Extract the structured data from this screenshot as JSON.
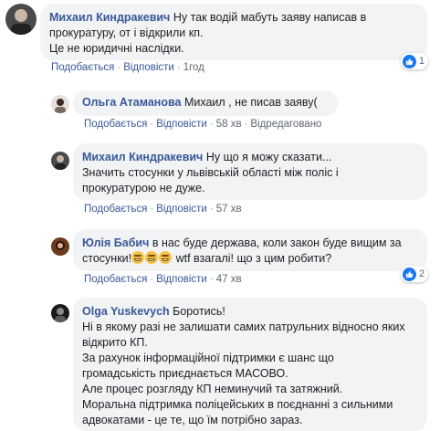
{
  "comments": [
    {
      "author": "Михаил Киндракевич",
      "lines": [
        "Ну так водій мабуть заяву написав в",
        "прокуратуру, от і відкрили кп.",
        "Це не юридичні наслідки."
      ],
      "like": "Подобається",
      "reply": "Відповісти",
      "time": "1год",
      "reaction_count": "1",
      "reaction_icon": "like-icon"
    },
    {
      "author": "Ольга Атаманова",
      "lines": [
        "Михаил , не писав заяву("
      ],
      "like": "Подобається",
      "reply": "Відповісти",
      "time": "58 хв",
      "edited": "Відредаговано"
    },
    {
      "author": "Михаил Киндракевич",
      "lines": [
        "Ну що я можу сказати...",
        "Значить стосунки у львівській області між поліс і",
        "прокуратурою не дуже."
      ],
      "like": "Подобається",
      "reply": "Відповісти",
      "time": "57 хв"
    },
    {
      "author": "Юлія Бабич",
      "lines": [
        "в нас буде держава, коли закон буде вищим за",
        "стосунки!",
        "wtf взагалі! що з цим робити?"
      ],
      "emoji": "grinning-face-emoji",
      "like": "Подобається",
      "reply": "Відповісти",
      "time": "47 хв",
      "reaction_count": "2",
      "reaction_icon": "like-icon"
    },
    {
      "author": "Olga Yuskevych",
      "lines": [
        "Боротись!",
        "Ні в якому разі не залишати самих патрульних відносно яких",
        "відкрито КП.",
        "За рахунок інформаційної підтримки є шанс що",
        "громадськість приєднається МАСОВО.",
        "Але процес розгляду КП неминучий та затяжний.",
        "Моральна підтримка поліцейських в поєднанні з сильними",
        "адвокатами - це те, що їм потрібно зараз."
      ]
    }
  ],
  "colors": {
    "name": "#385898",
    "bubble": "#f2f3f5",
    "like_blue": "#1877f2"
  }
}
